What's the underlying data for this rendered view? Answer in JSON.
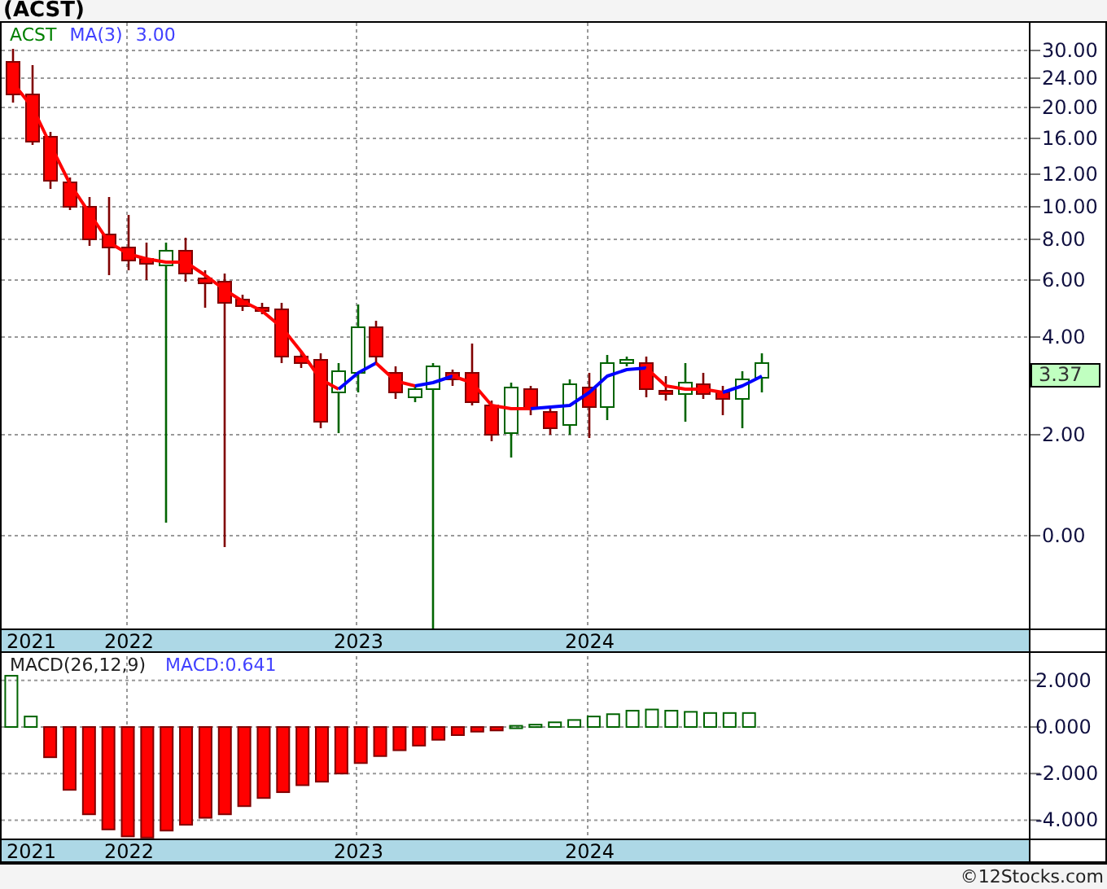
{
  "title": "(ACST)",
  "price_panel": {
    "legend": [
      {
        "text": "ACST",
        "color": "#008000"
      },
      {
        "text": "MA(3)",
        "color": "#4040ff"
      },
      {
        "text": "3.00",
        "color": "#4040ff"
      }
    ],
    "y_axis_labels": [
      "30.00",
      "24.00",
      "20.00",
      "16.00",
      "12.00",
      "10.00",
      "8.00",
      "6.00",
      "4.00",
      "2.00",
      "0.00"
    ],
    "last_price": "3.37",
    "x_axis_labels": [
      "2021",
      "2022",
      "2023",
      "2024"
    ]
  },
  "macd_panel": {
    "legend": [
      {
        "text": "MACD(26,12,9)",
        "color": "#202020"
      },
      {
        "text": "MACD:0.641",
        "color": "#4040ff"
      }
    ],
    "chart_data": {
      "type": "bar",
      "grid": true,
      "ylim": [
        -4.79,
        3.18
      ],
      "categories": [
        null,
        null,
        null,
        null,
        null,
        null,
        null,
        null,
        null,
        null,
        null,
        null,
        null,
        null,
        null,
        null,
        null,
        null,
        null,
        null,
        null,
        null,
        null,
        null,
        null,
        null,
        null,
        null,
        null,
        null,
        null,
        null,
        null,
        null,
        null,
        null,
        null,
        null,
        null,
        null,
        null,
        null,
        null,
        null,
        null,
        null,
        null,
        null,
        null,
        null,
        null,
        null,
        null
      ],
      "yticks": [
        {
          "value": 2,
          "label": "2.000"
        },
        {
          "value": 0,
          "label": "0.000"
        },
        {
          "value": -2,
          "label": "-2.000"
        },
        {
          "value": -4,
          "label": "-4.000"
        }
      ],
      "series": [
        {
          "color": "#006400",
          "values": [
            2.2,
            0.45,
            null,
            null,
            null,
            null,
            null,
            null,
            null,
            null,
            null,
            null,
            null,
            null,
            null,
            null,
            null,
            null,
            null,
            null,
            null,
            null,
            null,
            null,
            null,
            null,
            0.05,
            0.1,
            0.2,
            0.3,
            0.45,
            0.55,
            0.7,
            0.75,
            0.7,
            0.65,
            0.6,
            0.6,
            0.6,
            null,
            null,
            null,
            null,
            null,
            null,
            null,
            null,
            null,
            null,
            null,
            null,
            null,
            null
          ]
        },
        {
          "color": "#ff0000",
          "values": [
            null,
            null,
            -1.3,
            -2.7,
            -3.75,
            -4.4,
            -4.7,
            -4.75,
            -4.45,
            -4.2,
            -3.9,
            -3.75,
            -3.4,
            -3.05,
            -2.8,
            -2.5,
            -2.35,
            -2.0,
            -1.55,
            -1.25,
            -1.0,
            -0.8,
            -0.55,
            -0.35,
            -0.2,
            -0.15,
            null,
            null,
            null,
            null,
            null,
            null,
            null,
            null,
            null,
            null,
            null,
            null,
            null,
            null,
            null,
            null,
            null,
            null,
            null,
            null,
            null,
            null,
            null,
            null,
            null,
            null,
            null
          ]
        }
      ]
    },
    "x_axis_labels": [
      "2021",
      "2022",
      "2023",
      "2024"
    ]
  },
  "footer": "©12Stocks.com"
}
